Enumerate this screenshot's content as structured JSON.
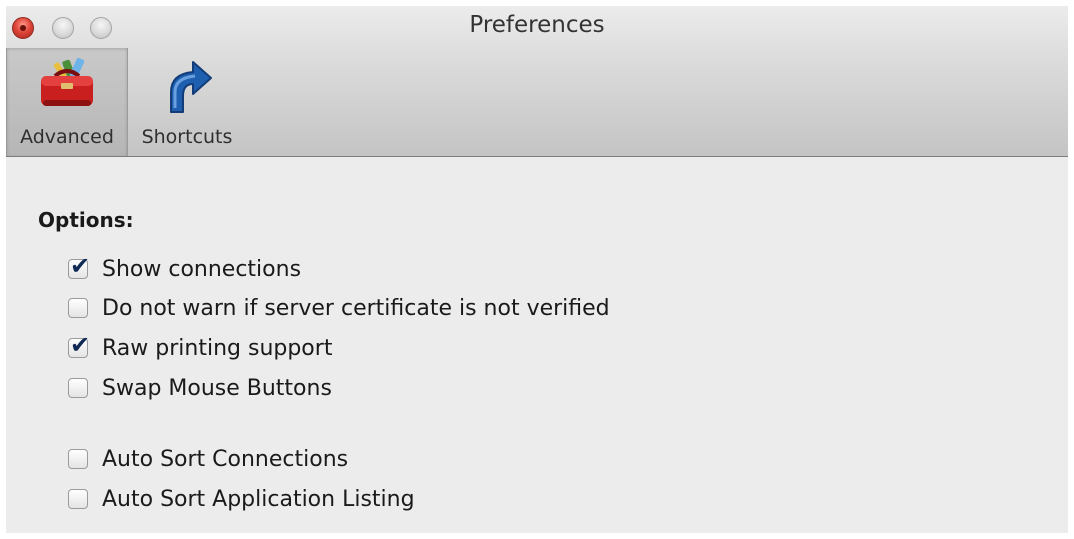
{
  "window": {
    "title": "Preferences"
  },
  "toolbar": {
    "items": [
      {
        "label": "Advanced",
        "icon": "toolbox-icon",
        "selected": true
      },
      {
        "label": "Shortcuts",
        "icon": "shortcut-arrow-icon",
        "selected": false
      }
    ]
  },
  "options": {
    "heading": "Options:",
    "items": [
      {
        "label": "Show connections",
        "checked": true
      },
      {
        "label": "Do not warn if server certificate is not verified",
        "checked": false
      },
      {
        "label": "Raw printing support",
        "checked": true
      },
      {
        "label": "Swap Mouse Buttons",
        "checked": false
      },
      {
        "label": "Auto Sort Connections",
        "checked": false
      },
      {
        "label": "Auto Sort Application Listing",
        "checked": false
      }
    ]
  },
  "colors": {
    "close_button": "#e0463a",
    "checkmark": "#102a55",
    "toolbox": "#c91f1f",
    "shortcut_arrow": "#1f5fb0"
  }
}
